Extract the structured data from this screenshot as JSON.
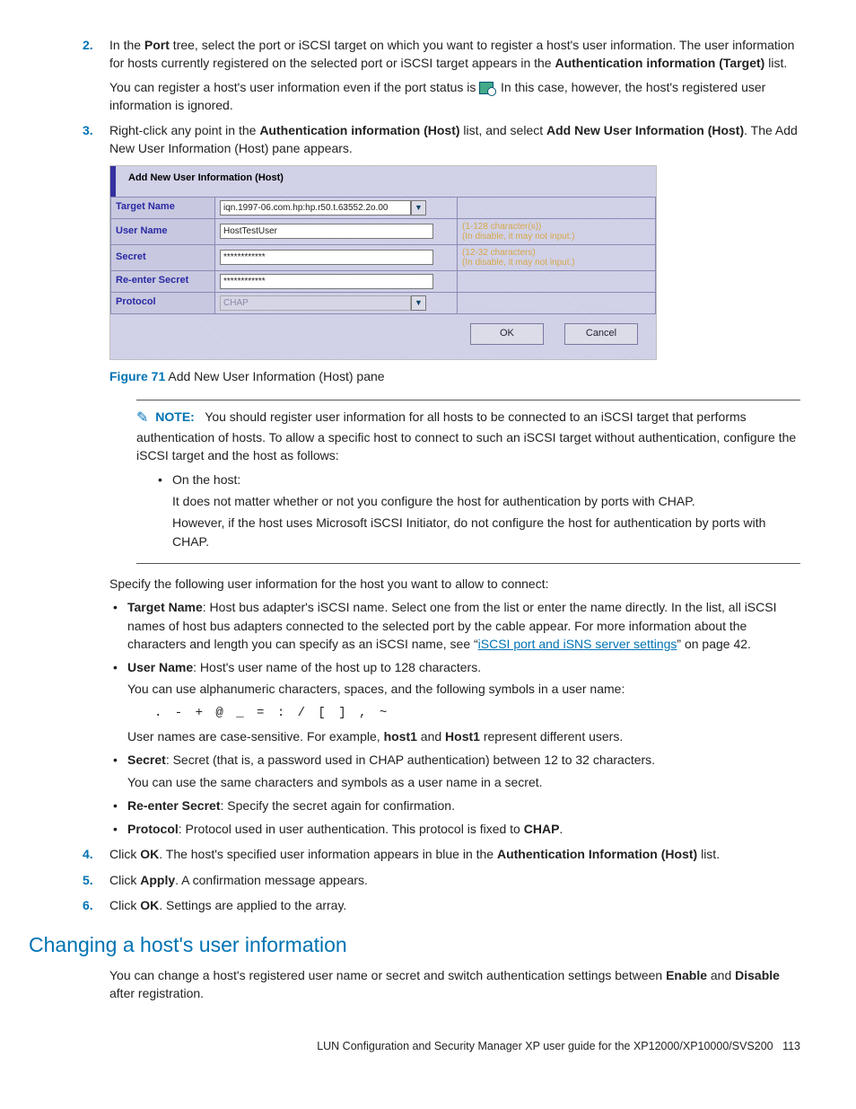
{
  "steps": {
    "s2": {
      "num": "2.",
      "run1a": "In the ",
      "run1b": "Port",
      "run1c": " tree, select the port or iSCSI target on which you want to register a host's user information. The user information for hosts currently registered on the selected port or iSCSI target appears in the ",
      "run1d": "Authentication information (Target)",
      "run1e": " list.",
      "run2a": "You can register a host's user information even if the port status is ",
      "run2b": ". In this case, however, the host's registered user information is ignored."
    },
    "s3": {
      "num": "3.",
      "run1a": "Right-click any point in the ",
      "run1b": "Authentication information (Host)",
      "run1c": " list, and select ",
      "run1d": "Add New User Information (Host)",
      "run1e": ". The Add New User Information (Host) pane appears."
    },
    "s4": {
      "num": "4.",
      "a": "Click ",
      "b": "OK",
      "c": ". The host's specified user information appears in blue in the ",
      "d": "Authentication Information (Host)",
      "e": " list."
    },
    "s5": {
      "num": "5.",
      "a": "Click ",
      "b": "Apply",
      "c": ". A confirmation message appears."
    },
    "s6": {
      "num": "6.",
      "a": "Click ",
      "b": "OK",
      "c": ". Settings are applied to the array."
    }
  },
  "figure": {
    "title": "Add New User Information (Host)",
    "labels": {
      "target": "Target Name",
      "user": "User Name",
      "secret": "Secret",
      "reenter": "Re-enter Secret",
      "protocol": "Protocol"
    },
    "values": {
      "target": "iqn.1997-06.com.hp:hp.r50.t.63552.2o.00",
      "user": "HostTestUser",
      "secret": "************",
      "reenter": "************",
      "protocol": "CHAP"
    },
    "hints": {
      "user": "(1-128 character(s))\n(In disable, it may not input.)",
      "secret": "(12-32 characters)\n(In disable, it may not input.)"
    },
    "buttons": {
      "ok": "OK",
      "cancel": "Cancel"
    }
  },
  "caption": {
    "label": "Figure 71",
    "text": " Add New User Information (Host) pane"
  },
  "note": {
    "label": "NOTE:",
    "body": "You should register user information for all hosts to be connected to an iSCSI target that performs authentication of hosts. To allow a specific host to connect to such an iSCSI target without authentication, configure the iSCSI target and the host as follows:",
    "bullet": "On the host:",
    "p1": "It does not matter whether or not you configure the host for authentication by ports with CHAP.",
    "p2": "However, if the host uses Microsoft iSCSI Initiator, do not configure the host for authentication by ports with CHAP."
  },
  "specify_intro": "Specify the following user information for the host you want to allow to connect:",
  "bullets": {
    "target": {
      "b": "Target Name",
      "t1": ": Host bus adapter's iSCSI name. Select one from the list or enter the name directly. In the list, all iSCSI names of host bus adapters connected to the selected port by the cable appear. For more information about the characters and length you can specify as an iSCSI name, see “",
      "link": "iSCSI port and iSNS server settings",
      "t2": "” on page 42."
    },
    "user": {
      "b": "User Name",
      "t": ": Host's user name of the host up to 128 characters.",
      "p1": "You can use alphanumeric characters, spaces, and the following symbols in a user name:",
      "symbols": ". - + @ _ = : / [ ] , ~",
      "p2a": "User names are case-sensitive. For example, ",
      "p2b": "host1",
      "p2c": " and ",
      "p2d": "Host1",
      "p2e": " represent different users."
    },
    "secret": {
      "b": "Secret",
      "t": ": Secret (that is, a password used in CHAP authentication) between 12 to 32 characters.",
      "p": "You can use the same characters and symbols as a user name in a secret."
    },
    "reenter": {
      "b": "Re-enter Secret",
      "t": ": Specify the secret again for confirmation."
    },
    "protocol": {
      "b": "Protocol",
      "t1": ": Protocol used in user authentication. This protocol is fixed to ",
      "t2": "CHAP",
      "t3": "."
    }
  },
  "section": {
    "heading": "Changing a host's user information",
    "p_a": "You can change a host's registered user name or secret and switch authentication settings between ",
    "p_b": "Enable",
    "p_c": " and ",
    "p_d": "Disable",
    "p_e": " after registration."
  },
  "footer": {
    "text": "LUN Configuration and Security Manager XP user guide for the XP12000/XP10000/SVS200",
    "page": "113"
  }
}
